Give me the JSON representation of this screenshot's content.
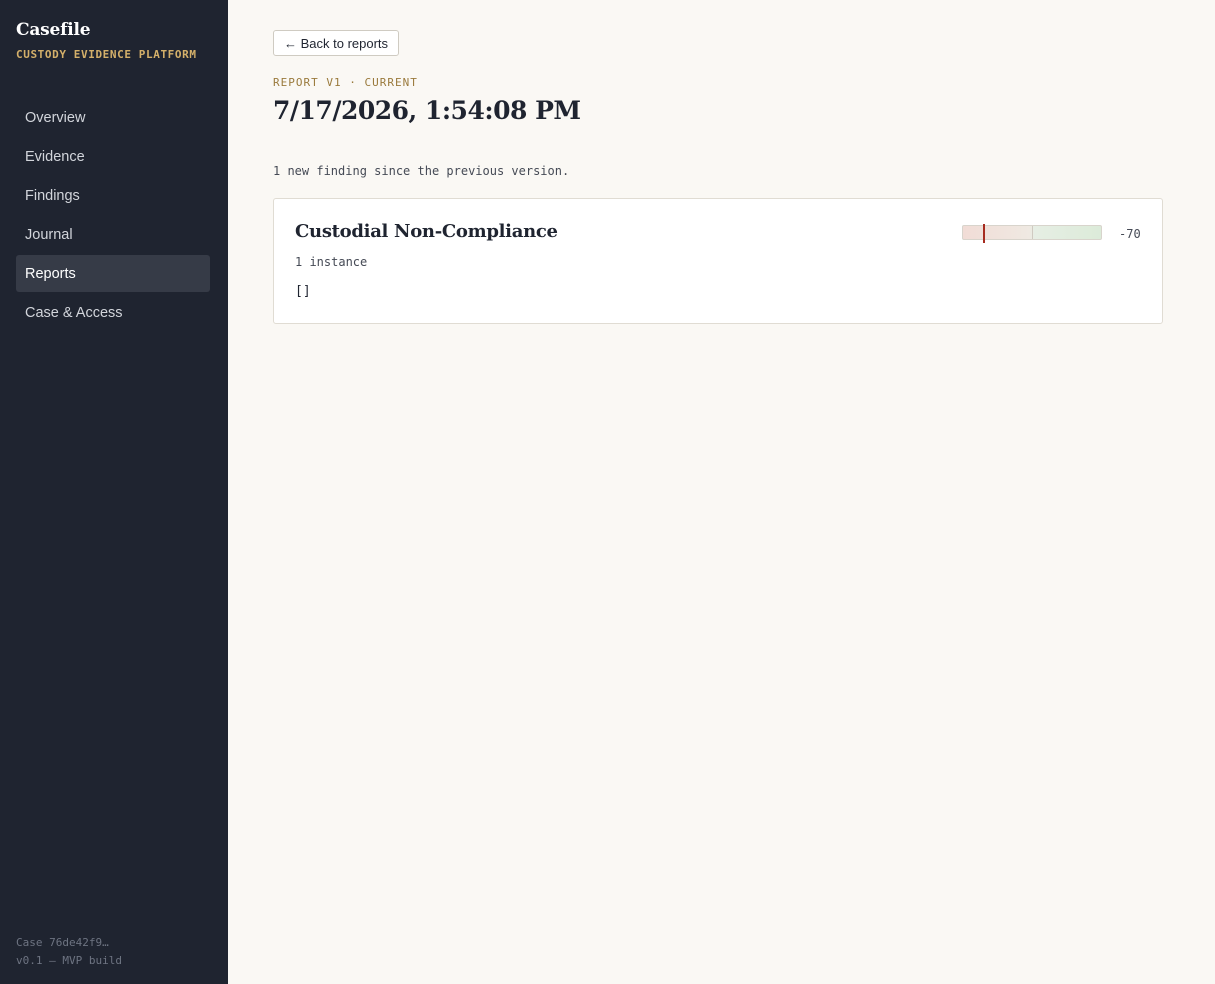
{
  "sidebar": {
    "brand_title": "Casefile",
    "brand_subtitle": "CUSTODY EVIDENCE PLATFORM",
    "items": [
      {
        "label": "Overview",
        "active": false
      },
      {
        "label": "Evidence",
        "active": false
      },
      {
        "label": "Findings",
        "active": false
      },
      {
        "label": "Journal",
        "active": false
      },
      {
        "label": "Reports",
        "active": true
      },
      {
        "label": "Case & Access",
        "active": false
      }
    ],
    "footer_case": "Case 76de42f9…",
    "footer_version": "v0.1 — MVP build"
  },
  "main": {
    "back_label": "← Back to reports",
    "eyebrow": "REPORT V1 · CURRENT",
    "title": "7/17/2026, 1:54:08 PM",
    "summary": "1 new finding since the previous version."
  },
  "finding": {
    "title": "Custodial Non-Compliance",
    "count": "1 instance",
    "body": "[]",
    "score": -70,
    "score_label": "-70",
    "score_range": [
      -100,
      100
    ],
    "colors": {
      "negative": "#f1dcd6",
      "positive": "#dcebd9",
      "marker": "#a62b1f"
    }
  },
  "colors": {
    "sidebar_bg": "#1f2430",
    "accent": "#d4b06a",
    "page_bg": "#faf8f4"
  }
}
